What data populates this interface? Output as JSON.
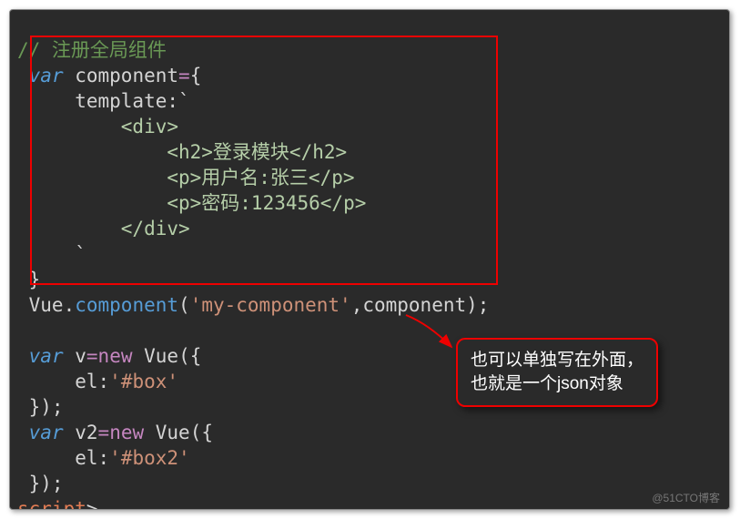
{
  "code": {
    "comment": "// 注册全局组件",
    "l2_a": "var",
    "l2_b": " component",
    "l2_c": "=",
    "l2_d": "{",
    "l3_a": "     template",
    "l3_b": ":`",
    "l4": "         <div>",
    "l5": "             <h2>登录模块</h2>",
    "l6": "             <p>用户名:张三</p>",
    "l7": "             <p>密码:123456</p>",
    "l8": "         </div>",
    "l9": "     `",
    "l10": " }",
    "l11_a": " Vue",
    "l11_b": ".",
    "l11_c": "component",
    "l11_d": "(",
    "l11_e": "'my-component'",
    "l11_f": ",component);",
    "blank": " ",
    "l13_a": "var",
    "l13_b": " v",
    "l13_c": "=",
    "l13_d": "new",
    "l13_e": " Vue",
    "l13_f": "({",
    "l14_a": "     el",
    "l14_b": ":",
    "l14_c": "'#box'",
    "l15": " });",
    "l16_a": "var",
    "l16_b": " v2",
    "l16_c": "=",
    "l16_d": "new",
    "l16_e": " Vue",
    "l16_f": "({",
    "l17_a": "     el",
    "l17_b": ":",
    "l17_c": "'#box2'",
    "l18": " });",
    "l19_a": "script",
    "l19_b": ">"
  },
  "callout_text": "也可以单独写在外面，也就是一个json对象",
  "watermark": "@51CTO博客"
}
